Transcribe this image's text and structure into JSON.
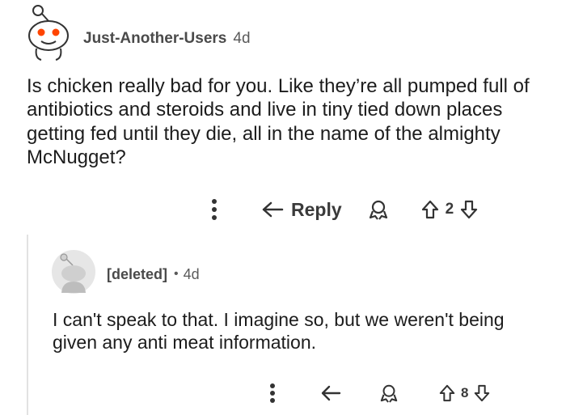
{
  "comments": [
    {
      "username": "Just-Another-Users",
      "age": "4d",
      "body": "Is chicken really bad for you. Like they’re all pumped full of antibiotics and steroids and live in tiny tied down places getting fed until they die, all in the name of the almighty McNugget?",
      "reply_label": "Reply",
      "vote_count": "2"
    },
    {
      "username": "[deleted]",
      "separator": "•",
      "age": "4d",
      "body": "I can't speak to that. I imagine so, but we weren't being given any anti meat information.",
      "vote_count": "8"
    }
  ],
  "icons": {
    "more": "more-options-icon",
    "reply": "reply-arrow-icon",
    "award": "award-icon",
    "upvote": "upvote-arrow-icon",
    "downvote": "downvote-arrow-icon"
  }
}
